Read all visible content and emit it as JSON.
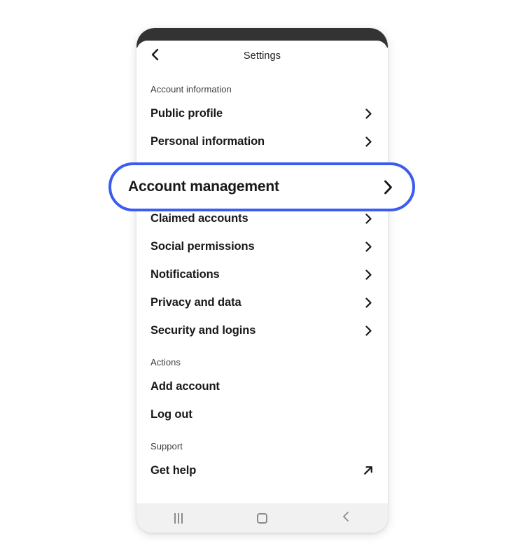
{
  "app": {
    "title": "Settings",
    "back_icon": "chevron-left-icon",
    "accent_color": "#3b5cf0",
    "bezel_color": "#333333",
    "navbar_color": "#f1f1f1"
  },
  "sections": [
    {
      "label": "Account information",
      "items": [
        {
          "label": "Public profile",
          "icon": "chevron-right-icon"
        },
        {
          "label": "Personal information",
          "icon": "chevron-right-icon"
        }
      ]
    },
    {
      "label": "",
      "items": [
        {
          "label": "Claimed accounts",
          "icon": "chevron-right-icon"
        },
        {
          "label": "Social permissions",
          "icon": "chevron-right-icon"
        },
        {
          "label": "Notifications",
          "icon": "chevron-right-icon"
        },
        {
          "label": "Privacy and data",
          "icon": "chevron-right-icon"
        },
        {
          "label": "Security and logins",
          "icon": "chevron-right-icon"
        }
      ]
    },
    {
      "label": "Actions",
      "items": [
        {
          "label": "Add account",
          "icon": ""
        },
        {
          "label": "Log out",
          "icon": ""
        }
      ]
    },
    {
      "label": "Support",
      "items": [
        {
          "label": "Get help",
          "icon": "external-link-icon"
        }
      ]
    }
  ],
  "highlighted_item": {
    "label": "Account management",
    "icon": "chevron-right-icon"
  },
  "navbar": {
    "recents_label": "recents-button",
    "home_label": "home-button",
    "back_label": "back-button"
  }
}
